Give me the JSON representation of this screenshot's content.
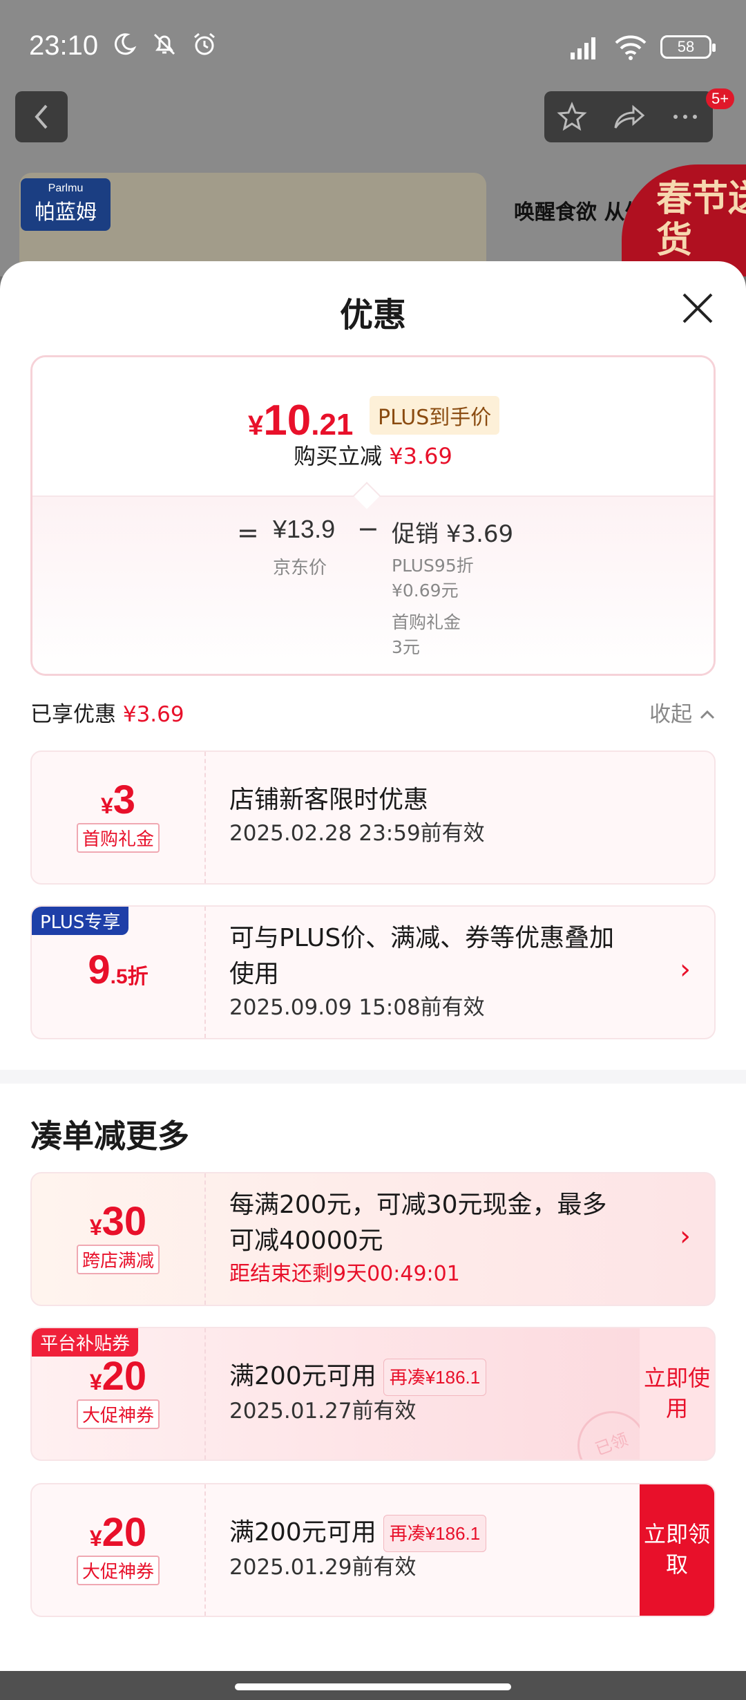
{
  "status_bar": {
    "time": "23:10",
    "battery": "58",
    "icons": [
      "moon-icon",
      "mute-bell-icon",
      "alarm-icon",
      "signal-icon",
      "wifi-icon"
    ]
  },
  "background_page": {
    "badge": "5+",
    "brand": "帕蓝姆",
    "brand_en": "Parlmu",
    "promo_text": "唤醒食欲 从外",
    "spring_stamp": "春节送货"
  },
  "sheet": {
    "title": "优惠",
    "summary": {
      "currency": "¥",
      "price_int": "10",
      "price_dec": ".21",
      "plus_tag": "PLUS到手价",
      "reduce_label": "购买立减",
      "reduce_value": "¥3.69",
      "equals": "=",
      "jd_price": "¥13.9",
      "jd_label": "京东价",
      "minus": "−",
      "promo_label": "促销",
      "promo_value": "¥3.69",
      "detail_1": "PLUS95折",
      "detail_2": "¥0.69元",
      "detail_3": "首购礼金",
      "detail_4": "3元"
    },
    "enjoyed_label": "已享优惠",
    "enjoyed_value": "¥3.69",
    "collapse_label": "收起",
    "coupons": [
      {
        "currency": "¥",
        "amount": "3",
        "type": "首购礼金",
        "title": "店铺新客限时优惠",
        "valid": "2025.02.28 23:59前有效"
      },
      {
        "corner": "PLUS专享",
        "amount": "9",
        "amount_suffix": ".5折",
        "title_line1": "可与PLUS价、满减、券等优惠叠加",
        "title_line2": "使用",
        "valid": "2025.09.09 15:08前有效"
      }
    ],
    "section_title": "凑单减更多",
    "more_coupons": [
      {
        "currency": "¥",
        "amount": "30",
        "type": "跨店满减",
        "title_line1": "每满200元，可减30元现金，最多",
        "title_line2": "可减40000元",
        "countdown": "距结束还剩9天00:49:01"
      },
      {
        "corner": "平台补贴券",
        "currency": "¥",
        "amount": "20",
        "type": "大促神券",
        "title": "满200元可用",
        "more": "再凑¥186.1",
        "valid": "2025.01.27前有效",
        "stamp": "已领",
        "button": "立即使用"
      },
      {
        "currency": "¥",
        "amount": "20",
        "type": "大促神券",
        "title": "满200元可用",
        "more": "再凑¥186.1",
        "valid": "2025.01.29前有效",
        "button": "立即领取"
      }
    ]
  }
}
